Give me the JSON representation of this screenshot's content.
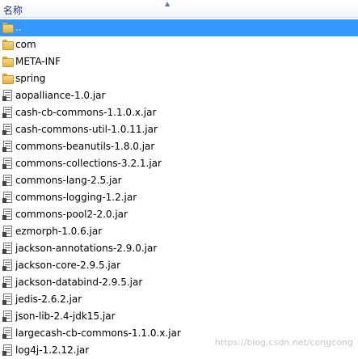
{
  "header": {
    "name_label": "名称"
  },
  "rows": [
    {
      "name": "..",
      "type": "folder",
      "selected": true
    },
    {
      "name": "com",
      "type": "folder"
    },
    {
      "name": "META-INF",
      "type": "folder"
    },
    {
      "name": "spring",
      "type": "folder"
    },
    {
      "name": "aopalliance-1.0.jar",
      "type": "jar"
    },
    {
      "name": "cash-cb-commons-1.1.0.x.jar",
      "type": "jar"
    },
    {
      "name": "cash-commons-util-1.0.11.jar",
      "type": "jar"
    },
    {
      "name": "commons-beanutils-1.8.0.jar",
      "type": "jar"
    },
    {
      "name": "commons-collections-3.2.1.jar",
      "type": "jar"
    },
    {
      "name": "commons-lang-2.5.jar",
      "type": "jar"
    },
    {
      "name": "commons-logging-1.2.jar",
      "type": "jar"
    },
    {
      "name": "commons-pool2-2.0.jar",
      "type": "jar"
    },
    {
      "name": "ezmorph-1.0.6.jar",
      "type": "jar"
    },
    {
      "name": "jackson-annotations-2.9.0.jar",
      "type": "jar"
    },
    {
      "name": "jackson-core-2.9.5.jar",
      "type": "jar"
    },
    {
      "name": "jackson-databind-2.9.5.jar",
      "type": "jar"
    },
    {
      "name": "jedis-2.6.2.jar",
      "type": "jar"
    },
    {
      "name": "json-lib-2.4-jdk15.jar",
      "type": "jar"
    },
    {
      "name": "largecash-cb-commons-1.1.0.x.jar",
      "type": "jar"
    },
    {
      "name": "log4j-1.2.12.jar",
      "type": "jar"
    }
  ],
  "watermark": "https://blog.csdn.net/congcong"
}
